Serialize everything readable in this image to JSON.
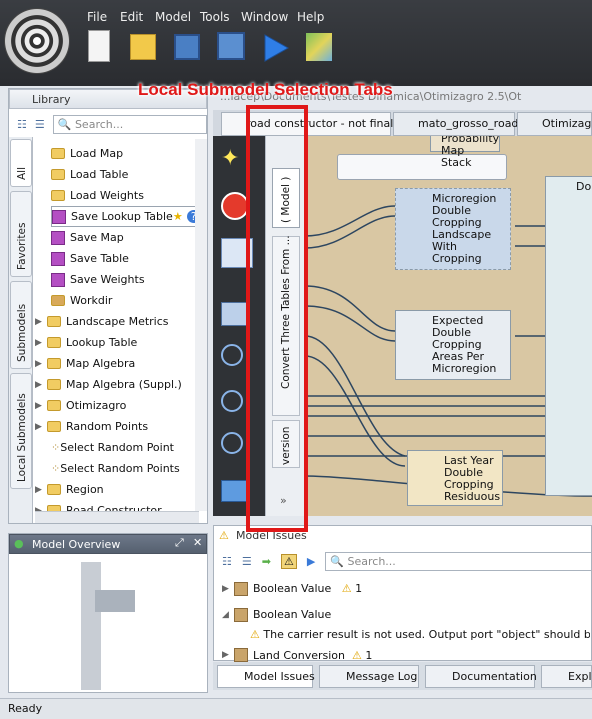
{
  "menu": [
    "File",
    "Edit",
    "Model",
    "Tools",
    "Window",
    "Help"
  ],
  "toolbar": [
    "new-file-icon",
    "open-folder-icon",
    "save-icon",
    "save-all-icon",
    "run-icon",
    "map-icon"
  ],
  "path_fragment": "...iacep\\Documents\\Testes Dinamica\\Otimizagro 2.5\\Ot",
  "library": {
    "title": "Library",
    "search_placeholder": "Search...",
    "vtabs": [
      "All",
      "Favorites",
      "Submodels",
      "Local Submodels"
    ],
    "items": [
      {
        "label": "Load Map",
        "kind": "folder",
        "indent": 2
      },
      {
        "label": "Load Table",
        "kind": "folder",
        "indent": 2
      },
      {
        "label": "Load Weights",
        "kind": "folder",
        "indent": 2
      },
      {
        "label": "Save Lookup Table",
        "kind": "fn",
        "indent": 2
      },
      {
        "label": "Save Map",
        "kind": "fn",
        "indent": 2
      },
      {
        "label": "Save Table",
        "kind": "fn",
        "indent": 2
      },
      {
        "label": "Save Weights",
        "kind": "fn",
        "indent": 2
      },
      {
        "label": "Workdir",
        "kind": "box",
        "indent": 2
      },
      {
        "label": "Landscape Metrics",
        "kind": "folder",
        "indent": 1
      },
      {
        "label": "Lookup Table",
        "kind": "folder",
        "indent": 1
      },
      {
        "label": "Map Algebra",
        "kind": "folder",
        "indent": 1
      },
      {
        "label": "Map Algebra (Suppl.)",
        "kind": "folder",
        "indent": 1
      },
      {
        "label": "Otimizagro",
        "kind": "folder",
        "indent": 1
      },
      {
        "label": "Random Points",
        "kind": "folder",
        "indent": 1
      },
      {
        "label": "Select Random Point",
        "kind": "dot",
        "indent": 2
      },
      {
        "label": "Select Random Points",
        "kind": "dot",
        "indent": 2
      },
      {
        "label": "Region",
        "kind": "folder",
        "indent": 1
      },
      {
        "label": "Road Constructor",
        "kind": "folder",
        "indent": 1
      }
    ]
  },
  "overview": {
    "title": "Model Overview"
  },
  "editor_tabs": [
    "road constructor - not final",
    "mato_grosso_road",
    "Otimizagr"
  ],
  "model_tabs": [
    "( Model )",
    "Convert Three Tables From ...",
    "version"
  ],
  "canvas": {
    "nodes": [
      "Probability Map Stack",
      "Microregion Double Cropping Landscape With Cropping",
      "Expected Double Cropping Areas Per Microregion",
      "Last Year Double Cropping Residuous",
      "Do"
    ]
  },
  "issues": {
    "title": "Model Issues",
    "search_placeholder": "Search...",
    "rows": [
      {
        "label": "Boolean Value",
        "count": "1"
      },
      {
        "label": "Boolean Value",
        "count": ""
      },
      {
        "label": "The carrier result is not used. Output port \"object\" should be conne",
        "count": ""
      },
      {
        "label": "Land Conversion",
        "count": "1"
      }
    ]
  },
  "bottom_tabs": [
    "Model Issues",
    "Message Log",
    "Documentation",
    "Explo"
  ],
  "status": "Ready",
  "callout": "Local Submodel Selection Tabs"
}
